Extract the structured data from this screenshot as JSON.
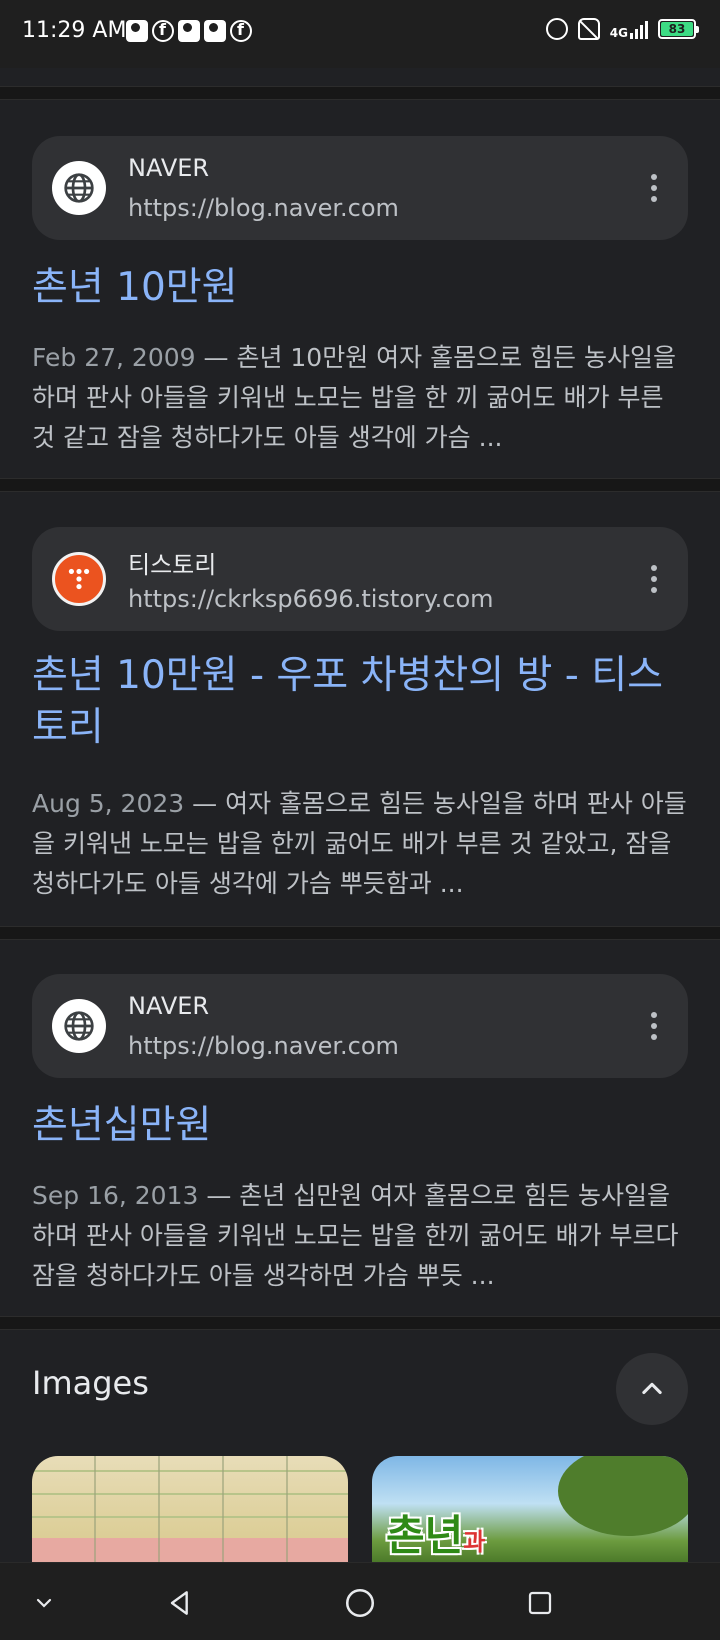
{
  "status_bar": {
    "time": "11:29 AM",
    "battery": "83",
    "network": "4G"
  },
  "results": [
    {
      "source_name": "NAVER",
      "source_url": "https://blog.naver.com",
      "favicon": "globe-icon",
      "title": "촌년 10만원",
      "date": "Feb 27, 2009",
      "snippet": " — 촌년 10만원 여자 홀몸으로 힘든 농사일을 하며 판사 아들을 키워낸 노모는 밥을 한 끼 굶어도 배가 부른 것 같고 잠을 청하다가도 아들 생각에 가슴 ..."
    },
    {
      "source_name": "티스토리",
      "source_url": "https://ckrksp6696.tistory.com",
      "favicon": "tistory-icon",
      "title": "촌년 10만원 - 우포 차병찬의 방 - 티스토리",
      "date": "Aug 5, 2023",
      "snippet": " — 여자 홀몸으로 힘든 농사일을 하며 판사 아들을 키워낸 노모는 밥을 한끼 굶어도 배가 부른 것 같았고, 잠을 청하다가도 아들 생각에 가슴 뿌듯함과 ..."
    },
    {
      "source_name": "NAVER",
      "source_url": "https://blog.naver.com",
      "favicon": "globe-icon",
      "title": "촌년십만원",
      "date": "Sep 16, 2013",
      "snippet": " — 촌년 십만원 여자 홀몸으로 힘든 농사일을 하며 판사 아들을 키워낸 노모는 밥을 한끼 굶어도 배가 부르다 잠을 청하다가도 아들 생각하면 가슴 뿌듯 ..."
    }
  ],
  "images": {
    "heading": "Images",
    "thumb2_text": "촌년",
    "thumb2_small": "과"
  }
}
